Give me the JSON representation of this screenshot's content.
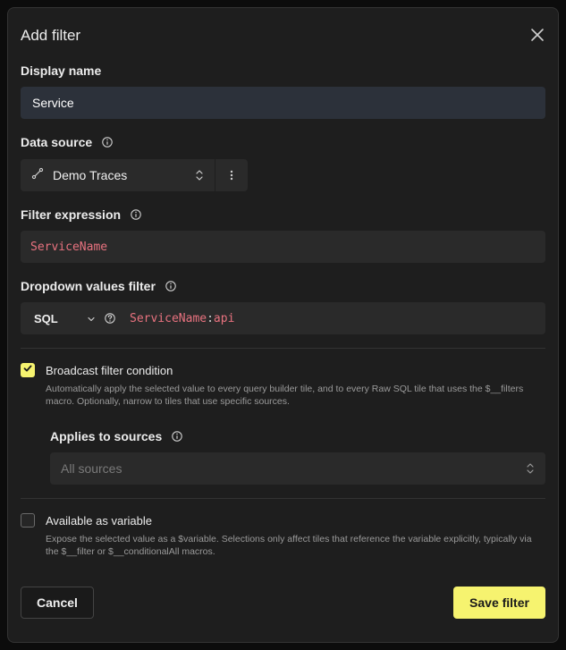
{
  "dialog": {
    "title": "Add filter"
  },
  "display_name": {
    "label": "Display name",
    "value": "Service"
  },
  "data_source": {
    "label": "Data source",
    "selected": "Demo Traces"
  },
  "filter_expression": {
    "label": "Filter expression",
    "value": "ServiceName"
  },
  "dropdown_values_filter": {
    "label": "Dropdown values filter",
    "language": "SQL",
    "expr_field": "ServiceName",
    "expr_colon": ":",
    "expr_value": "api"
  },
  "broadcast": {
    "checked": true,
    "label": "Broadcast filter condition",
    "description": "Automatically apply the selected value to every query builder tile, and to every Raw SQL tile that uses the $__filters macro. Optionally, narrow to tiles that use specific sources."
  },
  "applies_to_sources": {
    "label": "Applies to sources",
    "placeholder": "All sources"
  },
  "variable": {
    "checked": false,
    "label": "Available as variable",
    "description": "Expose the selected value as a $variable. Selections only affect tiles that reference the variable explicitly, typically via the $__filter or $__conditionalAll macros."
  },
  "footer": {
    "cancel_label": "Cancel",
    "save_label": "Save filter"
  },
  "colors": {
    "accent": "#f6f36f",
    "expression_text": "#e8727f",
    "background": "#1e1e1e"
  },
  "icons": {
    "close": "close-icon",
    "info": "info-icon",
    "source": "connection-icon",
    "updown": "updown-chevron-icon",
    "menu": "kebab-menu-icon",
    "chevron": "chevron-down-icon",
    "help": "question-circle-icon",
    "check": "check-icon"
  }
}
